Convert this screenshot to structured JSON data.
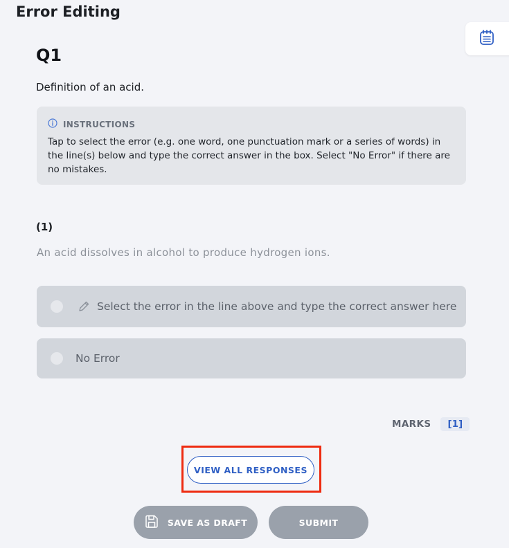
{
  "page": {
    "title": "Error Editing"
  },
  "side_panel": {
    "icon": "notes-icon"
  },
  "question": {
    "number": "Q1",
    "text": "Definition of an acid.",
    "instructions": {
      "icon": "info-icon",
      "heading": "INSTRUCTIONS",
      "body": "Tap to select the error (e.g. one word, one punctuation mark or a series of words) in the line(s) below and type the correct answer in the box. Select \"No Error\" if there are no mistakes."
    },
    "part": {
      "number": "(1)",
      "sentence": "An acid dissolves in alcohol to produce hydrogen ions.",
      "options": [
        {
          "label": "Select the error in the line above and type the correct answer here",
          "icon": "pencil-icon"
        },
        {
          "label": "No Error"
        }
      ]
    },
    "marks": {
      "label": "MARKS",
      "value": "[1]"
    }
  },
  "actions": {
    "view_all": "VIEW ALL RESPONSES",
    "save_draft": "SAVE AS DRAFT",
    "save_icon": "floppy-disk-icon",
    "submit": "SUBMIT"
  },
  "colors": {
    "accent": "#2f5fc4",
    "highlight": "#ee2b10",
    "disabled_button": "#9aa1ab"
  }
}
